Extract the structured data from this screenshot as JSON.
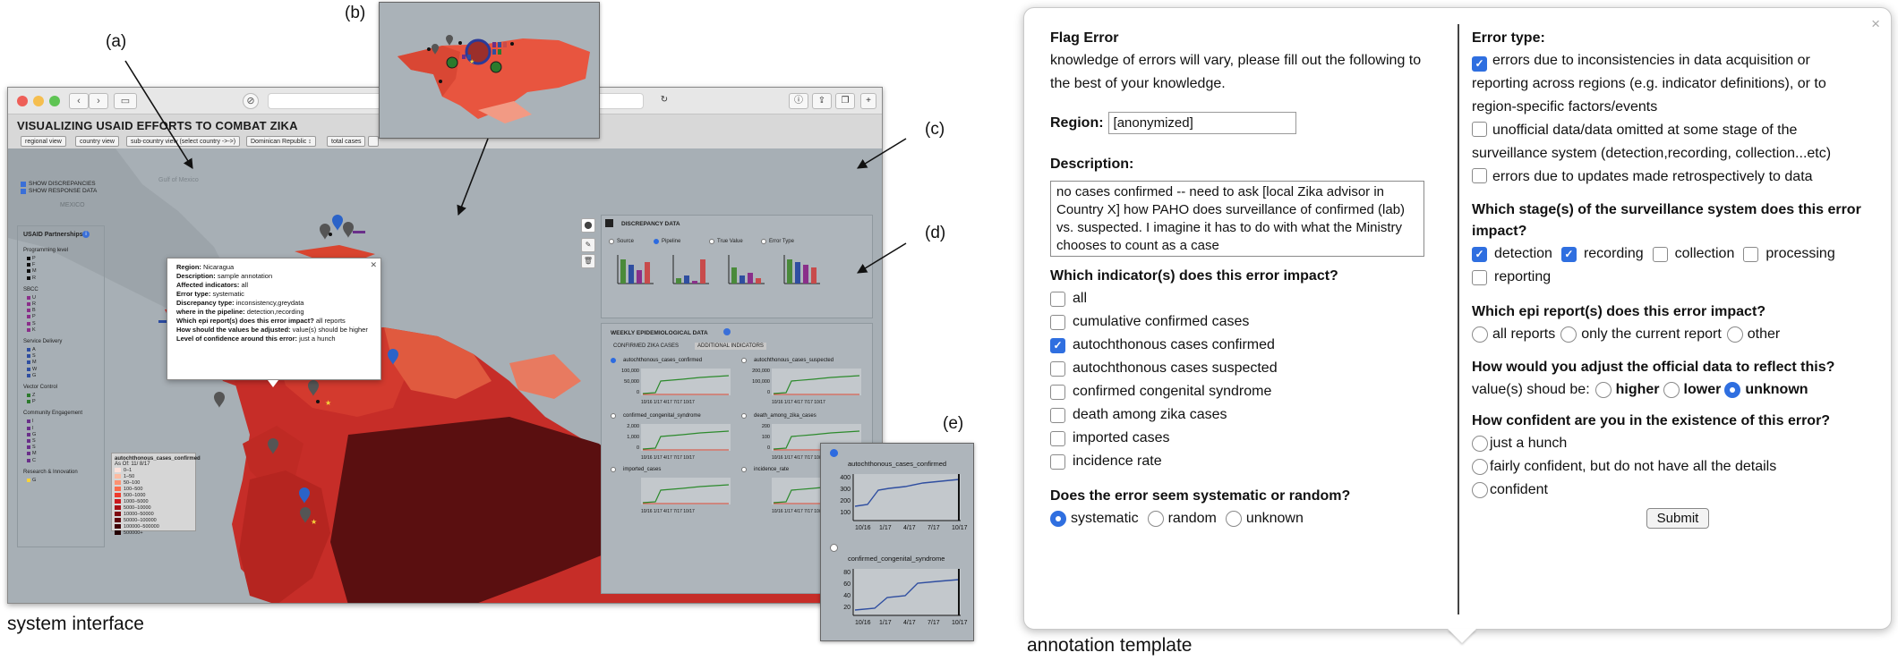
{
  "captions": {
    "left": "system interface",
    "right": "annotation template",
    "a": "(a)",
    "b": "(b)",
    "c": "(c)",
    "d": "(d)",
    "e": "(e)"
  },
  "app": {
    "title": "VISUALIZING USAID EFFORTS TO COMBAT ZIKA",
    "view_buttons": [
      "regional view",
      "country view",
      "sub-country view (select country ->->)",
      "Dominican Republic ↕",
      "total cases"
    ],
    "checks": [
      "SHOW DISCREPANCIES",
      "SHOW RESPONSE DATA"
    ],
    "map_labels": [
      "Gulf of Mexico",
      "MEXICO"
    ]
  },
  "partnerships": {
    "title": "USAID Partnerships",
    "groups": [
      {
        "name": "Programming level",
        "codes": [
          "P",
          "F",
          "M",
          "R"
        ]
      },
      {
        "name": "SBCC",
        "codes": [
          "U",
          "R",
          "B",
          "P",
          "S",
          "K"
        ]
      },
      {
        "name": "Service Delivery",
        "codes": [
          "A",
          "S",
          "M",
          "W",
          "G"
        ]
      },
      {
        "name": "Vector Control",
        "codes": [
          "Z",
          "P"
        ]
      },
      {
        "name": "Community Engagement",
        "codes": [
          "I",
          "I",
          "G",
          "S",
          "S",
          "M",
          "C"
        ]
      },
      {
        "name": "Research & Innovation",
        "codes": [
          "G"
        ]
      }
    ]
  },
  "legend": {
    "title": "autochthonous_cases_confirmed",
    "subtitle": "As Of: 11/ 8/17",
    "bins": [
      "0–1",
      "1–50",
      "50–100",
      "100–500",
      "500–1000",
      "1000–5000",
      "5000–10000",
      "10000–50000",
      "50000–100000",
      "100000–500000",
      "500000+"
    ],
    "colors": [
      "#fde0d9",
      "#fcbba1",
      "#fc9272",
      "#fb6a4a",
      "#ef3b2c",
      "#cb181d",
      "#a50f15",
      "#7f0a10",
      "#5e060b",
      "#3f0306",
      "#240103"
    ]
  },
  "popup": {
    "rows": [
      {
        "k": "Region:",
        "v": "Nicaragua"
      },
      {
        "k": "Description:",
        "v": "sample annotation"
      },
      {
        "k": "Affected indicators:",
        "v": "all"
      },
      {
        "k": "Error type:",
        "v": "systematic"
      },
      {
        "k": "Discrepancy type:",
        "v": "inconsistency,greydata"
      },
      {
        "k": "where in the pipeline:",
        "v": "detection,recording"
      },
      {
        "k": "Which epi report(s) does this error impact?",
        "v": "all reports"
      },
      {
        "k": "How should the values be adjusted:",
        "v": "value(s) should be higher"
      },
      {
        "k": "Level of confidence around this error:",
        "v": "just a hunch"
      }
    ]
  },
  "discrepancy": {
    "title": "DISCREPANCY DATA",
    "radios": [
      "Source",
      "Pipeline",
      "True Value",
      "Error Type"
    ],
    "selected": "Pipeline",
    "bar_colors": [
      "#4a8a3a",
      "#2f4ea0",
      "#8a2f8a",
      "#c84b4b"
    ]
  },
  "weekly": {
    "title": "WEEKLY EPIDEMIOLOGICAL DATA",
    "tabs": [
      "CONFIRMED ZIKA CASES",
      "ADDITIONAL INDICATORS"
    ],
    "charts": [
      {
        "label": "autochthonous_cases_confirmed",
        "ticks": [
          "100,000",
          "50,000",
          "0"
        ],
        "selected": true
      },
      {
        "label": "autochthonous_cases_suspected",
        "ticks": [
          "200,000",
          "100,000",
          "0"
        ],
        "selected": false
      },
      {
        "label": "confirmed_congenital_syndrome",
        "ticks": [
          "2,000",
          "1,000",
          "0"
        ],
        "selected": false
      },
      {
        "label": "death_among_zika_cases",
        "ticks": [
          "200",
          "100",
          "0"
        ],
        "selected": false
      },
      {
        "label": "imported_cases",
        "ticks": [],
        "selected": false
      },
      {
        "label": "incidence_rate",
        "ticks": [],
        "selected": false
      }
    ],
    "xticks": "10/16 1/17 4/17 7/17 10/17"
  },
  "inset_e": {
    "charts": [
      {
        "label": "autochthonous_cases_confirmed",
        "ticks": [
          "400",
          "300",
          "200",
          "100"
        ],
        "selected": true
      },
      {
        "label": "confirmed_congenital_syndrome",
        "ticks": [
          "80",
          "60",
          "40",
          "20"
        ],
        "selected": false
      }
    ],
    "xticks": [
      "10/16",
      "1/17",
      "4/17",
      "7/17",
      "10/17"
    ]
  },
  "annotation": {
    "title": "Flag Error",
    "intro": "knowledge of errors will vary, please fill out the following to the best of your knowledge.",
    "region_label": "Region:",
    "region_value": "[anonymized]",
    "description_label": "Description:",
    "description_value": "no cases confirmed -- need to ask [local Zika advisor in Country X] how PAHO does surveillance of confirmed (lab) vs. suspected. I imagine it has to do with what the Ministry chooses to count as a case",
    "indicator_question": "Which indicator(s) does this error impact?",
    "indicators": [
      {
        "label": "all",
        "checked": false
      },
      {
        "label": "cumulative confirmed cases",
        "checked": false
      },
      {
        "label": "autochthonous cases confirmed",
        "checked": true
      },
      {
        "label": "autochthonous cases suspected",
        "checked": false
      },
      {
        "label": "confirmed congenital syndrome",
        "checked": false
      },
      {
        "label": "death among zika cases",
        "checked": false
      },
      {
        "label": "imported cases",
        "checked": false
      },
      {
        "label": "incidence rate",
        "checked": false
      }
    ],
    "systematic_question": "Does the error seem systematic or random?",
    "systematic_options": [
      {
        "label": "systematic",
        "selected": true
      },
      {
        "label": "random",
        "selected": false
      },
      {
        "label": "unknown",
        "selected": false
      }
    ],
    "error_type_label": "Error type:",
    "error_types": [
      {
        "label": "errors due to inconsistencies in data acquisition or reporting across regions (e.g. indicator definitions), or to region-specific factors/events",
        "checked": true
      },
      {
        "label": "unofficial data/data omitted at some stage of the surveillance system (detection,recording, collection...etc)",
        "checked": false
      },
      {
        "label": "errors due to updates made retrospectively to data",
        "checked": false
      }
    ],
    "stage_question": "Which stage(s) of the surveillance system does this error impact?",
    "stages": [
      {
        "label": "detection",
        "checked": true
      },
      {
        "label": "recording",
        "checked": true
      },
      {
        "label": "collection",
        "checked": false
      },
      {
        "label": "processing",
        "checked": false
      },
      {
        "label": "reporting",
        "checked": false
      }
    ],
    "report_question": "Which epi report(s) does this error impact?",
    "reports": [
      {
        "label": "all reports",
        "selected": false
      },
      {
        "label": "only the current report",
        "selected": false
      },
      {
        "label": "other",
        "selected": false
      }
    ],
    "adjust_question": "How would you adjust the official data to reflect this?",
    "adjust_prefix": "value(s) shoud be:",
    "adjust_options": [
      {
        "label": "higher",
        "selected": false
      },
      {
        "label": "lower",
        "selected": false
      },
      {
        "label": "unknown",
        "selected": true
      }
    ],
    "confidence_question": "How confident are you in the existence of this error?",
    "confidence_options": [
      {
        "label": "just a hunch",
        "selected": false
      },
      {
        "label": "fairly confident, but do not have all the details",
        "selected": false
      },
      {
        "label": "confident",
        "selected": false
      }
    ],
    "submit_label": "Submit",
    "close_glyph": "×"
  }
}
